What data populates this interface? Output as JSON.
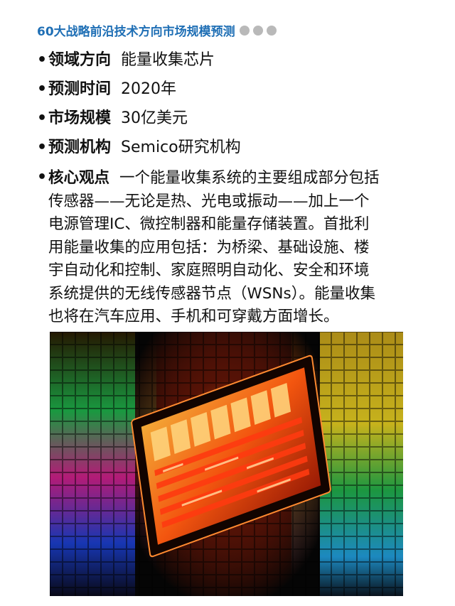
{
  "header": {
    "title": "60大战略前沿技术方向市场规模预测"
  },
  "items": [
    {
      "key": "领域方向",
      "value": "能量收集芯片"
    },
    {
      "key": "预测时间",
      "value": "2020年"
    },
    {
      "key": "市场规模",
      "value": "30亿美元"
    },
    {
      "key": "预测机构",
      "value": "Semico研究机构"
    }
  ],
  "core": {
    "key": "核心观点",
    "first_line": "一个能量收集系统的主要组成部分包括",
    "lines": [
      "传感器——无论是热、光电或振动——加上一个",
      "电源管理IC、微控制器和能量存储装置。首批利",
      "用能量收集的应用包括：为桥梁、基础设施、楼",
      "宇自动化和控制、家庭照明自动化、安全和环境",
      "系统提供的无线传感器节点（WSNs）。能量收集",
      "也将在汽车应用、手机和可穿戴方面增长。"
    ]
  },
  "bullet_char": "•",
  "colors": {
    "title": "#1f6fb5",
    "dots": "#b9b9b9"
  }
}
